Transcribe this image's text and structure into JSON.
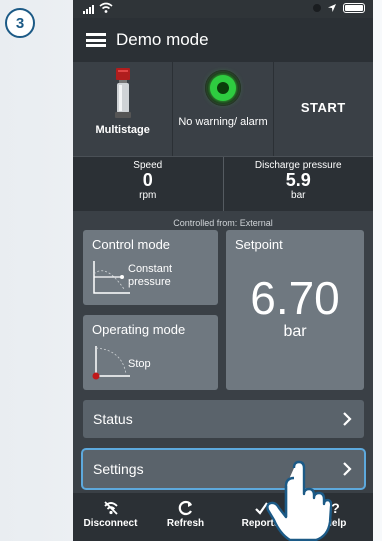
{
  "step_badge": "3",
  "header": {
    "title": "Demo mode"
  },
  "status_cards": {
    "pump_label": "Multistage",
    "alarm_label": "No warning/ alarm",
    "start_label": "START"
  },
  "readings": {
    "speed": {
      "label": "Speed",
      "value": "0",
      "unit": "rpm"
    },
    "discharge": {
      "label": "Discharge pressure",
      "value": "5.9",
      "unit": "bar"
    }
  },
  "controlled_from": "Controlled from: External",
  "control_mode": {
    "title": "Control mode",
    "value_line1": "Constant",
    "value_line2": "pressure"
  },
  "operating_mode": {
    "title": "Operating mode",
    "value": "Stop"
  },
  "setpoint": {
    "title": "Setpoint",
    "value": "6.70",
    "unit": "bar"
  },
  "menu": {
    "status_label": "Status",
    "settings_label": "Settings"
  },
  "bottom_tabs": [
    {
      "label": "Disconnect",
      "icon": "disconnect-icon"
    },
    {
      "label": "Refresh",
      "icon": "refresh-icon"
    },
    {
      "label": "Reports",
      "icon": "reports-icon"
    },
    {
      "label": "Help",
      "icon": "help-icon"
    }
  ],
  "colors": {
    "badge": "#1c5a86",
    "header_bg": "#2b3035",
    "tile_bg": "#6f7880",
    "highlight": "#5da9dd",
    "alarm_ok": "#2ecc40"
  }
}
